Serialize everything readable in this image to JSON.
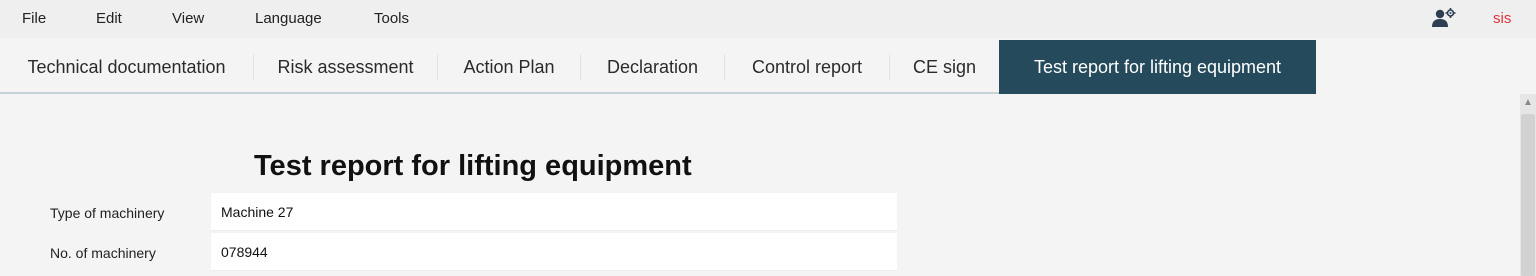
{
  "menu": {
    "items": [
      "File",
      "Edit",
      "View",
      "Language",
      "Tools"
    ]
  },
  "user": {
    "icon": "user-settings-icon",
    "name": "sis",
    "color": "#e2333a"
  },
  "tabs": [
    {
      "label": "Technical documentation",
      "active": false
    },
    {
      "label": "Risk assessment",
      "active": false
    },
    {
      "label": "Action Plan",
      "active": false
    },
    {
      "label": "Declaration",
      "active": false
    },
    {
      "label": "Control report",
      "active": false
    },
    {
      "label": "CE sign",
      "active": false
    },
    {
      "label": "Test report for lifting equipment",
      "active": true
    }
  ],
  "colors": {
    "active_tab": "#244a5c",
    "background": "#f4f4f4"
  },
  "form": {
    "title": "Test report for lifting equipment",
    "fields": [
      {
        "label": "Type of machinery",
        "value": "Machine 27"
      },
      {
        "label": "No. of machinery",
        "value": "078944"
      }
    ]
  }
}
